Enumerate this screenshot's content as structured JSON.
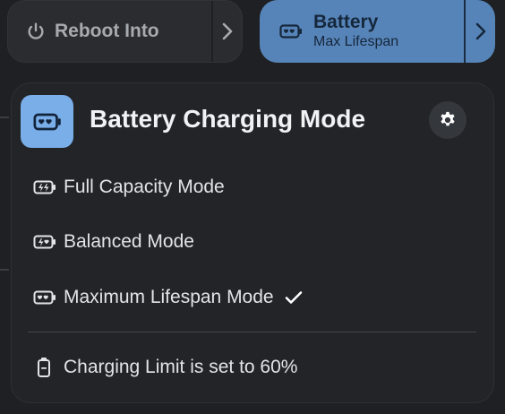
{
  "quick_settings": {
    "reboot": {
      "label": "Reboot Into",
      "icon": "power-icon"
    },
    "battery": {
      "label": "Battery",
      "sublabel": "Max Lifespan",
      "icon": "battery-heart-icon",
      "active": true,
      "accent": "#5784b8"
    }
  },
  "menu": {
    "title": "Battery Charging Mode",
    "header_icon": "battery-heart-icon",
    "header_icon_bg": "#79aee9",
    "items": [
      {
        "label": "Full Capacity Mode",
        "icon": "battery-bolt-icon",
        "selected": false
      },
      {
        "label": "Balanced Mode",
        "icon": "battery-bolt-heart-icon",
        "selected": false
      },
      {
        "label": "Maximum Lifespan Mode",
        "icon": "battery-heart-icon",
        "selected": true
      }
    ],
    "status": {
      "label": "Charging Limit is set to 60%",
      "icon": "battery-vertical-icon"
    }
  }
}
